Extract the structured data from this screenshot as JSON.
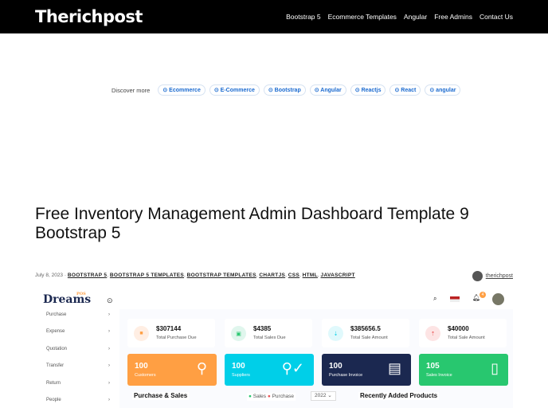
{
  "site": {
    "logo": "Therichpost",
    "menu": [
      "Bootstrap 5",
      "Ecommerce Templates",
      "Angular",
      "Free Admins",
      "Contact Us"
    ]
  },
  "discover": {
    "label": "Discover more",
    "chips": [
      "Ecommerce",
      "E-Commerce",
      "Bootstrap",
      "Angular",
      "Reactjs",
      "React",
      "angular"
    ]
  },
  "article": {
    "title": "Free Inventory Management Admin Dashboard Template 9 Bootstrap 5",
    "date": "July 8, 2023 ·",
    "tags": [
      "BOOTSTRAP 5",
      "BOOTSTRAP 5 TEMPLATES",
      "BOOTSTRAP TEMPLATES",
      "CHARTJS",
      "CSS",
      "HTML",
      "JAVASCRIPT"
    ],
    "author": "therichpost"
  },
  "dash": {
    "brand": "Dreams",
    "brand_sup": "POS",
    "notif_count": "4",
    "sidebar": [
      "Purchase",
      "Expense",
      "Quotation",
      "Transfer",
      "Return",
      "People"
    ],
    "stats": [
      {
        "value": "$307144",
        "label": "Total Purchase Due",
        "bg": "#ffeee3",
        "color": "#ff9f43"
      },
      {
        "value": "$4385",
        "label": "Total Sales Due",
        "bg": "#e0f6ed",
        "color": "#28c76f"
      },
      {
        "value": "$385656.5",
        "label": "Total Sale Amount",
        "bg": "#e0f9fc",
        "color": "#00cfe8"
      },
      {
        "value": "$40000",
        "label": "Total Sale Amount",
        "bg": "#fde4e4",
        "color": "#ea5455"
      }
    ],
    "counts": [
      {
        "value": "100",
        "label": "Customers",
        "color": "#ff9f43"
      },
      {
        "value": "100",
        "label": "Suppliers",
        "color": "#00cfe8"
      },
      {
        "value": "100",
        "label": "Purchase Invoice",
        "color": "#1b2850"
      },
      {
        "value": "105",
        "label": "Sales Invoice",
        "color": "#28c76f"
      }
    ],
    "chart_title": "Purchase & Sales",
    "legend": [
      "Sales",
      "Purchase"
    ],
    "year": "2022",
    "products_title": "Recently Added Products"
  }
}
